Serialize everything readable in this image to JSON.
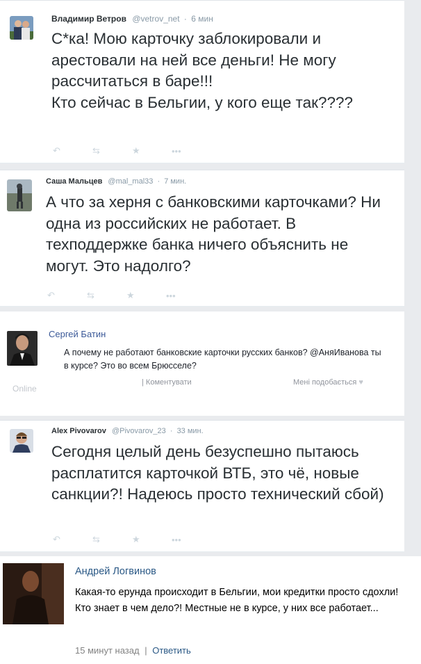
{
  "posts": [
    {
      "name": "Владимир Ветров",
      "handle": "@vetrov_net",
      "time": "6 мин",
      "text": "С*ка! Мою карточку заблокировали и арестовали на ней все деньги! Не могу рассчитаться в баре!!!\nКто сейчас в Бельгии, у кого еще так????",
      "avatar_icon": "couple-photo-avatar"
    },
    {
      "name": "Саша Мальцев",
      "handle": "@mal_mal33",
      "time": "7 мин.",
      "text": "А что за херня с банковскими карточками? Ни одна из российских не работает. В техподдержке банка ничего объяснить не могут. Это надолго?",
      "avatar_icon": "landscape-photo-avatar"
    },
    {
      "name": "Сергей Батин",
      "text": "А почему не работают банковские карточки русских банков? @АняИванова ты в курсе? Это во всем Брюсселе?",
      "status": "Online",
      "comment_label": "| Коментувати",
      "like_label": "Мені подобається",
      "avatar_icon": "man-portrait-avatar"
    },
    {
      "name": "Alex Pivovarov",
      "handle": "@Pivovarov_23",
      "time": "33 мин.",
      "text": "Сегодня целый день безуспешно пытаюсь расплатится карточкой ВТБ, это чё, новые санкции?! Надеюсь просто технический сбой)",
      "avatar_icon": "sunglasses-man-avatar"
    },
    {
      "name": "Андрей Логвинов",
      "text": "Какая-то ерунда происходит в Бельгии, мои кредитки просто сдохли! Кто знает в чем дело?! Местные не в курсе, у них все работает...",
      "time": "15 минут назад",
      "separator": "|",
      "reply_label": "Ответить",
      "avatar_icon": "dark-silhouette-avatar"
    }
  ],
  "tweet_action_icons": [
    "reply-icon",
    "retweet-icon",
    "favorite-icon",
    "more-icon"
  ],
  "colors": {
    "twitter_name": "#292f33",
    "twitter_meta": "#8899a6",
    "fb_link": "#3b5998",
    "vk_link": "#2a5885"
  }
}
